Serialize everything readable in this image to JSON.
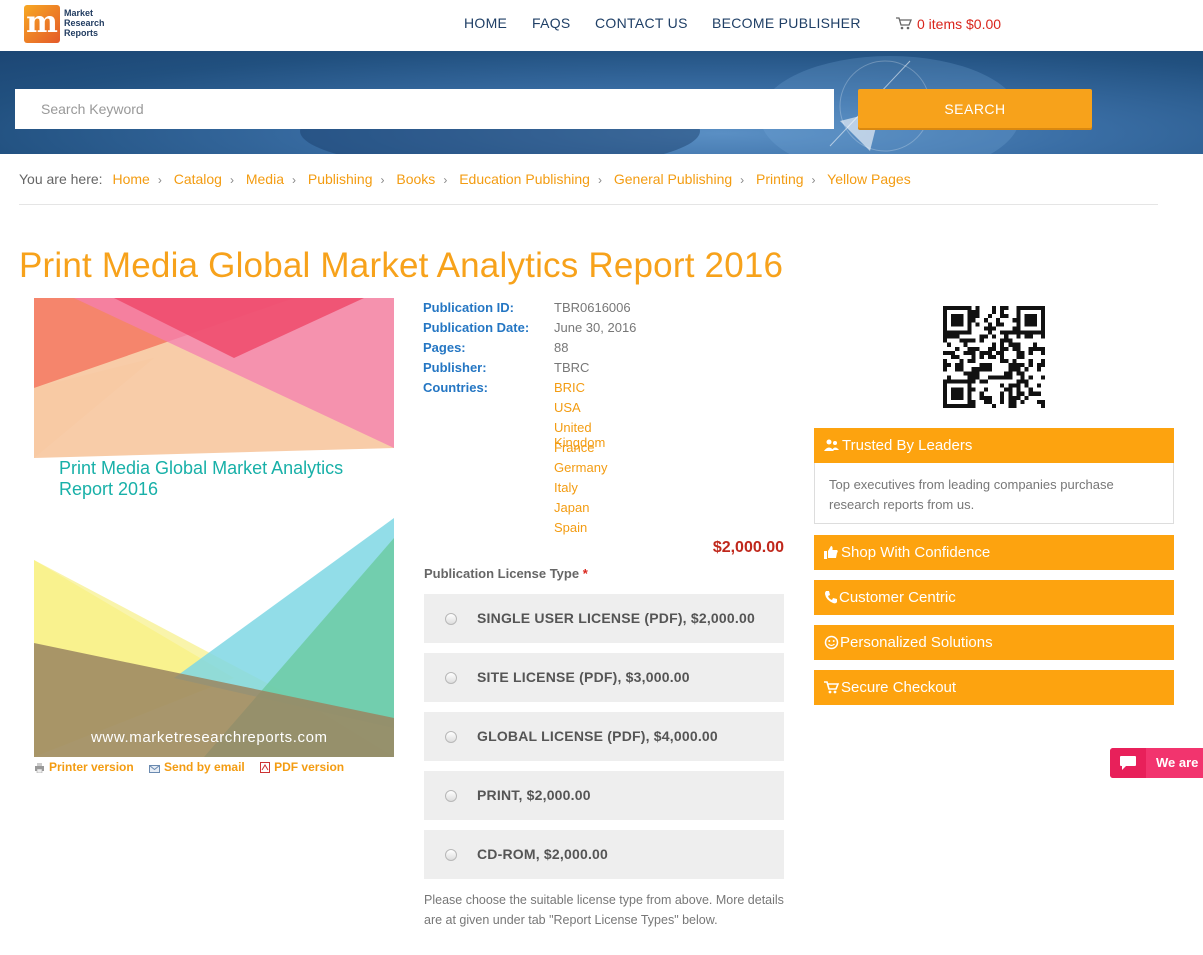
{
  "header": {
    "logo_text": "Market Research Reports",
    "nav": [
      "HOME",
      "FAQS",
      "CONTACT US",
      "BECOME PUBLISHER"
    ],
    "cart": "0 items $0.00"
  },
  "search": {
    "placeholder": "Search Keyword",
    "button": "SEARCH"
  },
  "breadcrumb": {
    "lead": "You are here:",
    "items": [
      "Home",
      "Catalog",
      "Media",
      "Publishing",
      "Books",
      "Education Publishing",
      "General Publishing",
      "Printing",
      "Yellow Pages"
    ]
  },
  "report": {
    "title": "Print Media Global Market Analytics Report 2016",
    "cover_title": "Print Media Global Market Analytics Report 2016",
    "cover_url": "www.marketresearchreports.com",
    "actions": [
      "Printer version",
      "Send by email",
      "PDF version"
    ],
    "details": [
      {
        "label": "Publication ID:",
        "value": "TBR0616006"
      },
      {
        "label": "Publication Date:",
        "value": "June 30, 2016"
      },
      {
        "label": "Pages:",
        "value": "88"
      },
      {
        "label": "Publisher:",
        "value": "TBRC"
      }
    ],
    "countries_label": "Countries:",
    "countries": [
      "BRIC",
      "USA",
      "United Kingdom",
      "France",
      "Germany",
      "Italy",
      "Japan",
      "Spain"
    ],
    "price": "$2,000.00"
  },
  "license": {
    "heading": "Publication License Type",
    "required_mark": "*",
    "options": [
      "SINGLE USER LICENSE (PDF), $2,000.00",
      "SITE LICENSE (PDF), $3,000.00",
      "GLOBAL LICENSE (PDF), $4,000.00",
      "PRINT, $2,000.00",
      "CD-ROM, $2,000.00"
    ],
    "note": "Please choose the suitable license type from above. More details are at given under tab \"Report License Types\" below."
  },
  "sidebar": {
    "trusted_title": "Trusted By Leaders",
    "trusted_body": "Top executives from leading companies purchase research reports from us.",
    "boxes": [
      "Shop With Confidence",
      "Customer Centric",
      "Personalized Solutions",
      "Secure Checkout"
    ]
  },
  "chat": {
    "label": "We are"
  },
  "colors": {
    "accent": "#f7a21b",
    "link_blue": "#2476c3",
    "price_red": "#c0281c",
    "nav_blue": "#1f3f66"
  }
}
